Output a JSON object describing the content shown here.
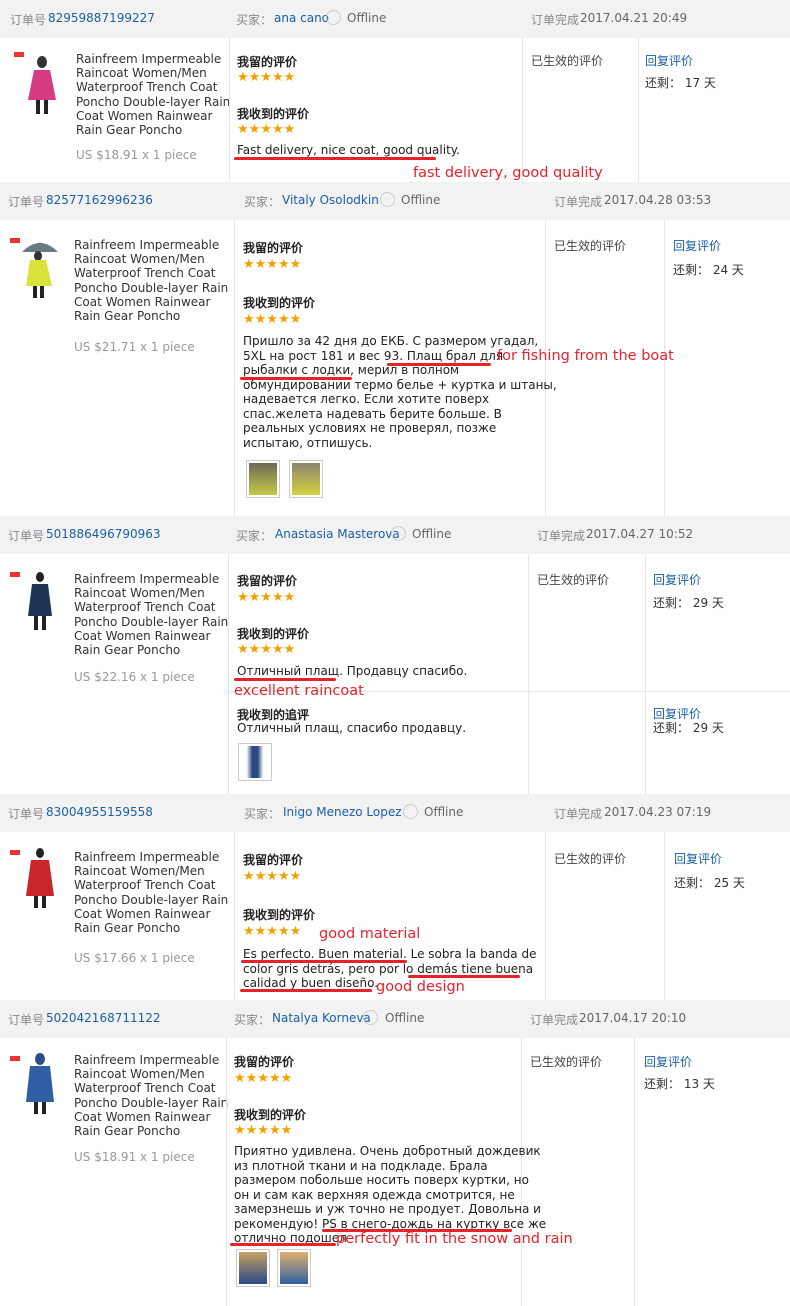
{
  "labels": {
    "order_no": "订单号",
    "buyer": "买家：",
    "completed": "订单完成",
    "my_review": "我留的评价",
    "received_review": "我收到的评价",
    "followup": "我收到的追评",
    "effective": "已生效的评价",
    "reply": "回复评价",
    "remaining_prefix": "还剩：",
    "offline": "Offline",
    "stars": "★★★★★"
  },
  "product_title": "Rainfreem Impermeable Raincoat Women/Men Waterproof Trench Coat Poncho Double-layer Rain Coat Women Rainwear Rain Gear Poncho",
  "orders": [
    {
      "order_no": "82959887199227",
      "buyer": "ana cano",
      "date": "2017.04.21 20:49",
      "price": "US $18.91 x 1 piece",
      "remaining": "17 天",
      "review": "Fast delivery, nice coat, good quality.",
      "annotation": "fast delivery, good quality"
    },
    {
      "order_no": "82577162996236",
      "buyer": "Vitaly Osolodkin",
      "date": "2017.04.28 03:53",
      "price": "US $21.71 x 1 piece",
      "remaining": "24 天",
      "review_lines": [
        "Пришло за 42 дня до ЕКБ. С размером угадал,",
        "5XL на рост 181 и вес 93. Плащ брал для",
        "рыбалки с лодки, мерил в полном",
        "обмундировании термо белье + куртка и штаны,",
        "надевается легко. Если хотите поверх",
        "спас.желета надевать берите больше. В",
        "реальных условиях не проверял, позже",
        "испытаю, отпишусь."
      ],
      "annotation": "for fishing from the boat"
    },
    {
      "order_no": "501886496790963",
      "buyer": "Anastasia Masterova",
      "date": "2017.04.27 10:52",
      "price": "US $22.16 x 1 piece",
      "remaining": "29 天",
      "review": "Отличный плащ. Продавцу спасибо.",
      "annotation": "excellent raincoat",
      "followup_text": "Отличный плащ, спасибо продавцу.",
      "followup_remaining": "29 天"
    },
    {
      "order_no": "83004955159558",
      "buyer": "Inigo Menezo Lopez",
      "date": "2017.04.23 07:19",
      "price": "US $17.66 x 1 piece",
      "remaining": "25 天",
      "review_lines": [
        "Es perfecto. Buen material. Le sobra la banda de",
        "color gris detrás, pero por lo demás tiene buena",
        "calidad y buen diseño."
      ],
      "annotation_1": "good material",
      "annotation_2": "good design"
    },
    {
      "order_no": "502042168711122",
      "buyer": "Natalya Korneva",
      "date": "2017.04.17 20:10",
      "price": "US $18.91 x 1 piece",
      "remaining": "13 天",
      "review_lines": [
        "Приятно удивлена. Очень добротный дождевик",
        "из плотной ткани и на подкладе. Брала",
        "размером побольше носить поверх куртки, но",
        "он и сам как верхняя одежда смотрится, не",
        "замерзнешь и уж точно не продует. Довольна и",
        "рекомендую! PS в снего-дождь на куртку все же",
        "отлично подошел"
      ],
      "annotation": "perfectly fit in the snow and rain"
    }
  ],
  "colors": {
    "link": "#1a5fa8",
    "star": "#f5a000",
    "annotation": "#e8222a",
    "header_bg": "#f2f2f2"
  }
}
